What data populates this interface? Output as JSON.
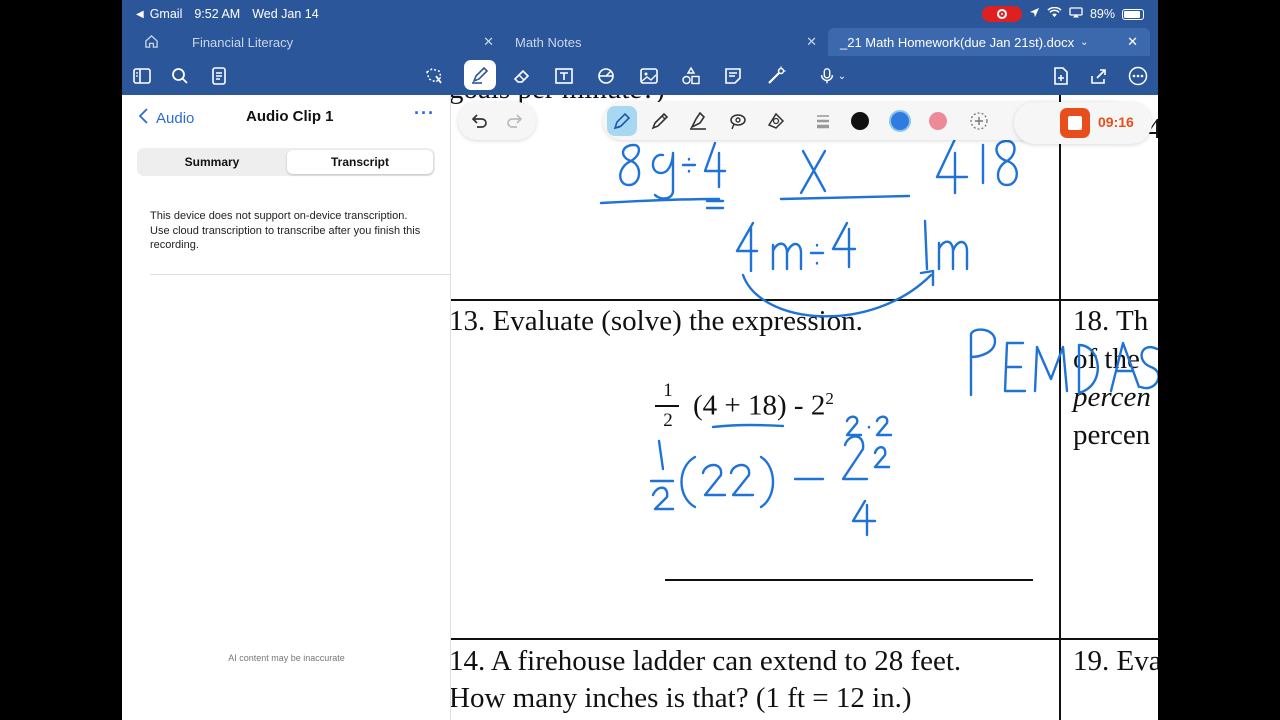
{
  "status_bar": {
    "back_app": "Gmail",
    "time": "9:52 AM",
    "date": "Wed Jan 14",
    "battery": "89%",
    "battery_level": 0.89
  },
  "tabs": [
    {
      "label": "Financial Literacy"
    },
    {
      "label": "Math Notes"
    },
    {
      "label": "_21 Math Homework(due Jan 21st).docx"
    }
  ],
  "sidebar": {
    "back_label": "Audio",
    "title": "Audio Clip 1",
    "segments": [
      "Summary",
      "Transcript"
    ],
    "selected_segment": "Transcript",
    "message": "This device does not support on-device transcription. Use cloud transcription to transcribe after you finish this recording.",
    "ai_note": "AI content may be inaccurate"
  },
  "recorder": {
    "elapsed": "09:16"
  },
  "ink_colors": {
    "black": "#111111",
    "blue": "#2f7be0",
    "pink": "#ee8a98",
    "accent": "#2b579a",
    "ink": "#1f72d6"
  },
  "document": {
    "top_partial": "goals per minute?)",
    "q13_label": "13. Evaluate (solve) the expression.",
    "q13_frac_num": "1",
    "q13_frac_den": "2",
    "q13_expr": "(4 + 18) - 2",
    "q13_exp": "2",
    "q14_line1": "14. A firehouse ladder can extend to 28 feet.",
    "q14_line2": "How many inches is that? (1 ft = 12 in.)",
    "q18_line1": "18. Th",
    "q18_line2": "of the",
    "q18_line3": "percen",
    "q18_line4": "percen",
    "q19_line1": "19. Eva",
    "right_partial_top": "4"
  },
  "handwriting": {
    "fraction_top_left": "8g÷4",
    "fraction_top_right": "x",
    "fraction_result": "418",
    "fraction_bottom_left": "4m÷4",
    "fraction_bottom_right": "1m",
    "pemdas": "PEMDAS",
    "step1": "1/2(22) - 2²",
    "step_exp": "2·2",
    "step_result": "4"
  }
}
